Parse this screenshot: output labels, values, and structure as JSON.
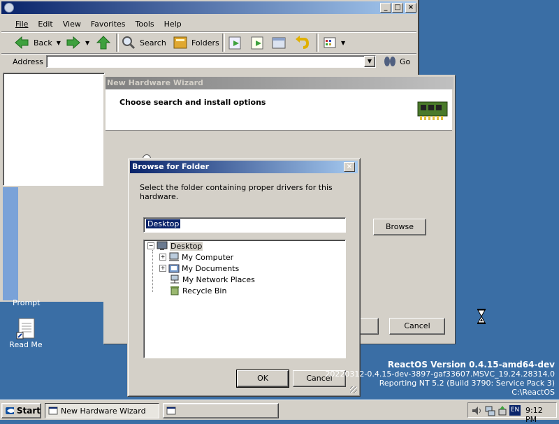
{
  "explorer": {
    "menu": [
      "File",
      "Edit",
      "View",
      "Favorites",
      "Tools",
      "Help"
    ],
    "toolbar": {
      "back": "Back",
      "search": "Search",
      "folders": "Folders"
    },
    "address_label": "Address",
    "address_value": "",
    "go_label": "Go"
  },
  "wizard": {
    "title": "New Hardware Wizard",
    "heading": "Choose search and install options",
    "browse_label": "Browse",
    "cancel_label": "Cancel"
  },
  "browse_dialog": {
    "title": "Browse for Folder",
    "instruction": "Select the folder containing proper drivers for this hardware.",
    "folder_value": "Desktop",
    "tree": [
      {
        "label": "Desktop",
        "icon": "desktop-icon",
        "expander": "−"
      },
      {
        "label": "My Computer",
        "icon": "computer-icon",
        "expander": "+"
      },
      {
        "label": "My Documents",
        "icon": "documents-icon",
        "expander": "+"
      },
      {
        "label": "My Network Places",
        "icon": "network-icon",
        "expander": ""
      },
      {
        "label": "Recycle Bin",
        "icon": "recycle-bin-icon",
        "expander": ""
      }
    ],
    "ok_label": "OK",
    "cancel_label": "Cancel"
  },
  "desktop": {
    "prompt_label": "Prompt",
    "readme_label": "Read Me",
    "version_lines": [
      "ReactOS Version 0.4.15-amd64-dev",
      "20220312-0.4.15-dev-3897-gaf33607.MSVC_19.24.28314.0",
      "Reporting NT 5.2 (Build 3790: Service Pack 3)",
      "C:\\ReactOS"
    ]
  },
  "taskbar": {
    "start_label": "Start",
    "task_wizard": "New Hardware Wizard",
    "task_blank": "",
    "language": "EN",
    "clock": "9:12 PM"
  }
}
